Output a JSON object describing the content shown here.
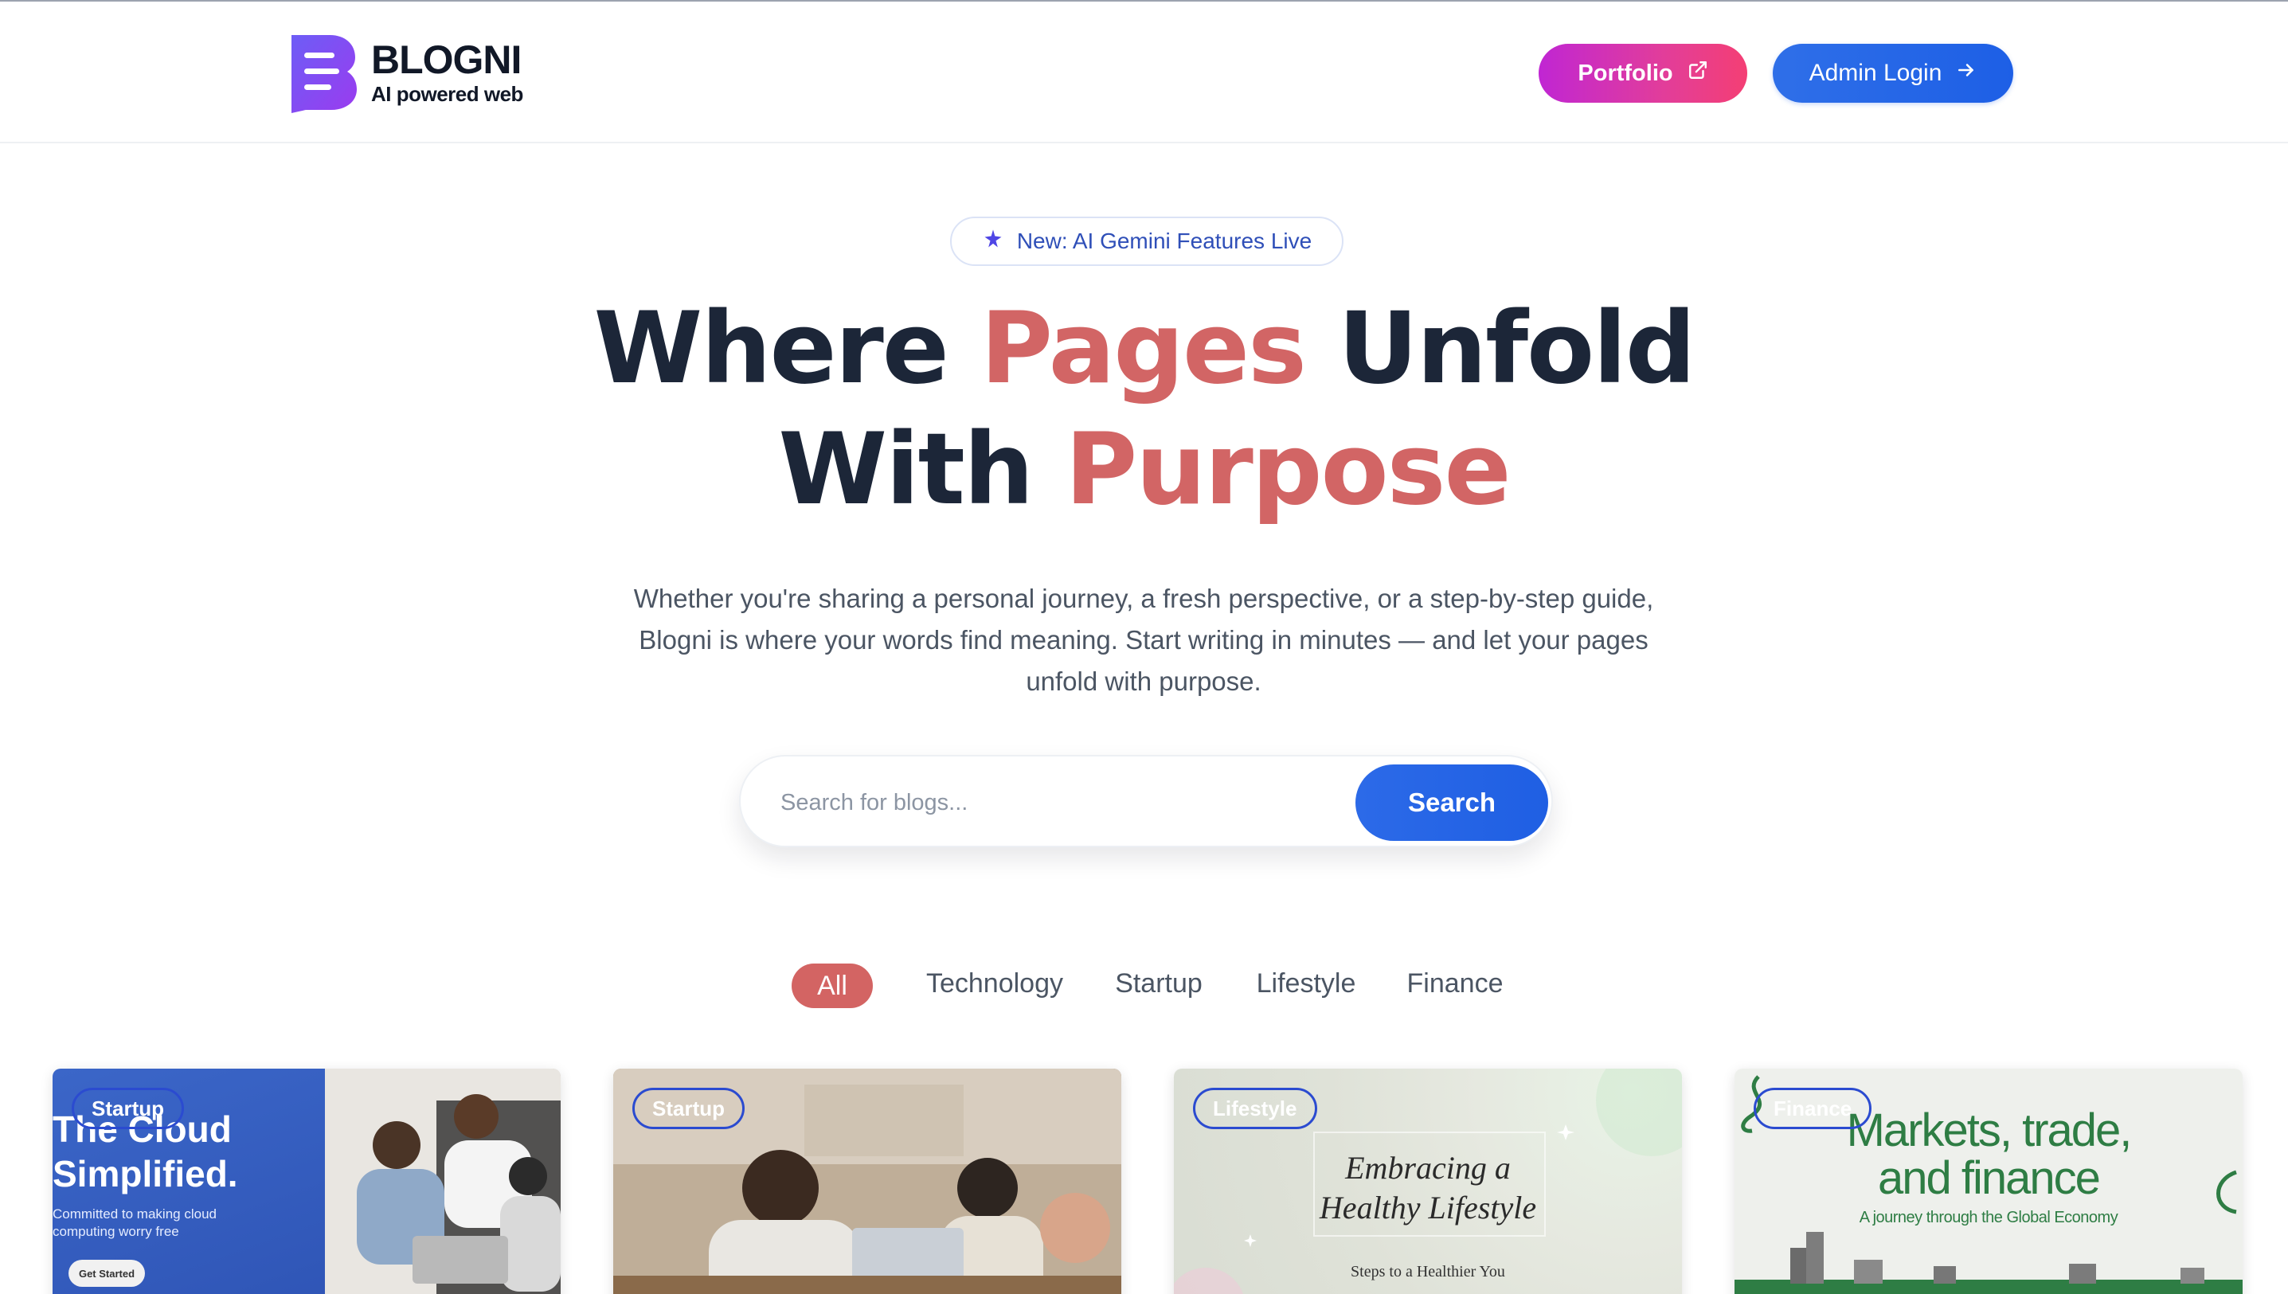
{
  "brand": {
    "name": "BLOGNI",
    "tagline": "AI powered web",
    "color": "#7c3aed"
  },
  "nav": {
    "portfolio_label": "Portfolio",
    "admin_label": "Admin Login"
  },
  "hero": {
    "badge": "New: AI Gemini Features Live",
    "title_line1_a": "Where ",
    "title_line1_b": "Pages",
    "title_line1_c": " Unfold",
    "title_line2_a": "With ",
    "title_line2_b": "Purpose",
    "subtitle_line1": "Whether you're sharing a personal journey, a fresh perspective, or a step-by-step guide,",
    "subtitle_line2": "Blogni is where your words find meaning. Start writing in minutes — and let your pages",
    "subtitle_line3": "unfold with purpose.",
    "accent_color": "#d26565"
  },
  "search": {
    "placeholder": "Search for blogs...",
    "button_label": "Search"
  },
  "categories": [
    "All",
    "Technology",
    "Startup",
    "Lifestyle",
    "Finance"
  ],
  "active_category": "All",
  "cards": [
    {
      "category": "Startup",
      "title_line1": "The Cloud",
      "title_line2": "Simplified.",
      "subtitle_line1": "Committed to making cloud",
      "subtitle_line2": "computing worry free",
      "cta": "Get Started"
    },
    {
      "category": "Startup"
    },
    {
      "category": "Lifestyle",
      "title_line1": "Embracing a",
      "title_line2": "Healthy Lifestyle",
      "subtitle": "Steps to a Healthier You"
    },
    {
      "category": "Finance",
      "title_line1": "Markets, trade,",
      "title_line2": "and finance",
      "subtitle": "A journey through the Global Economy"
    }
  ]
}
